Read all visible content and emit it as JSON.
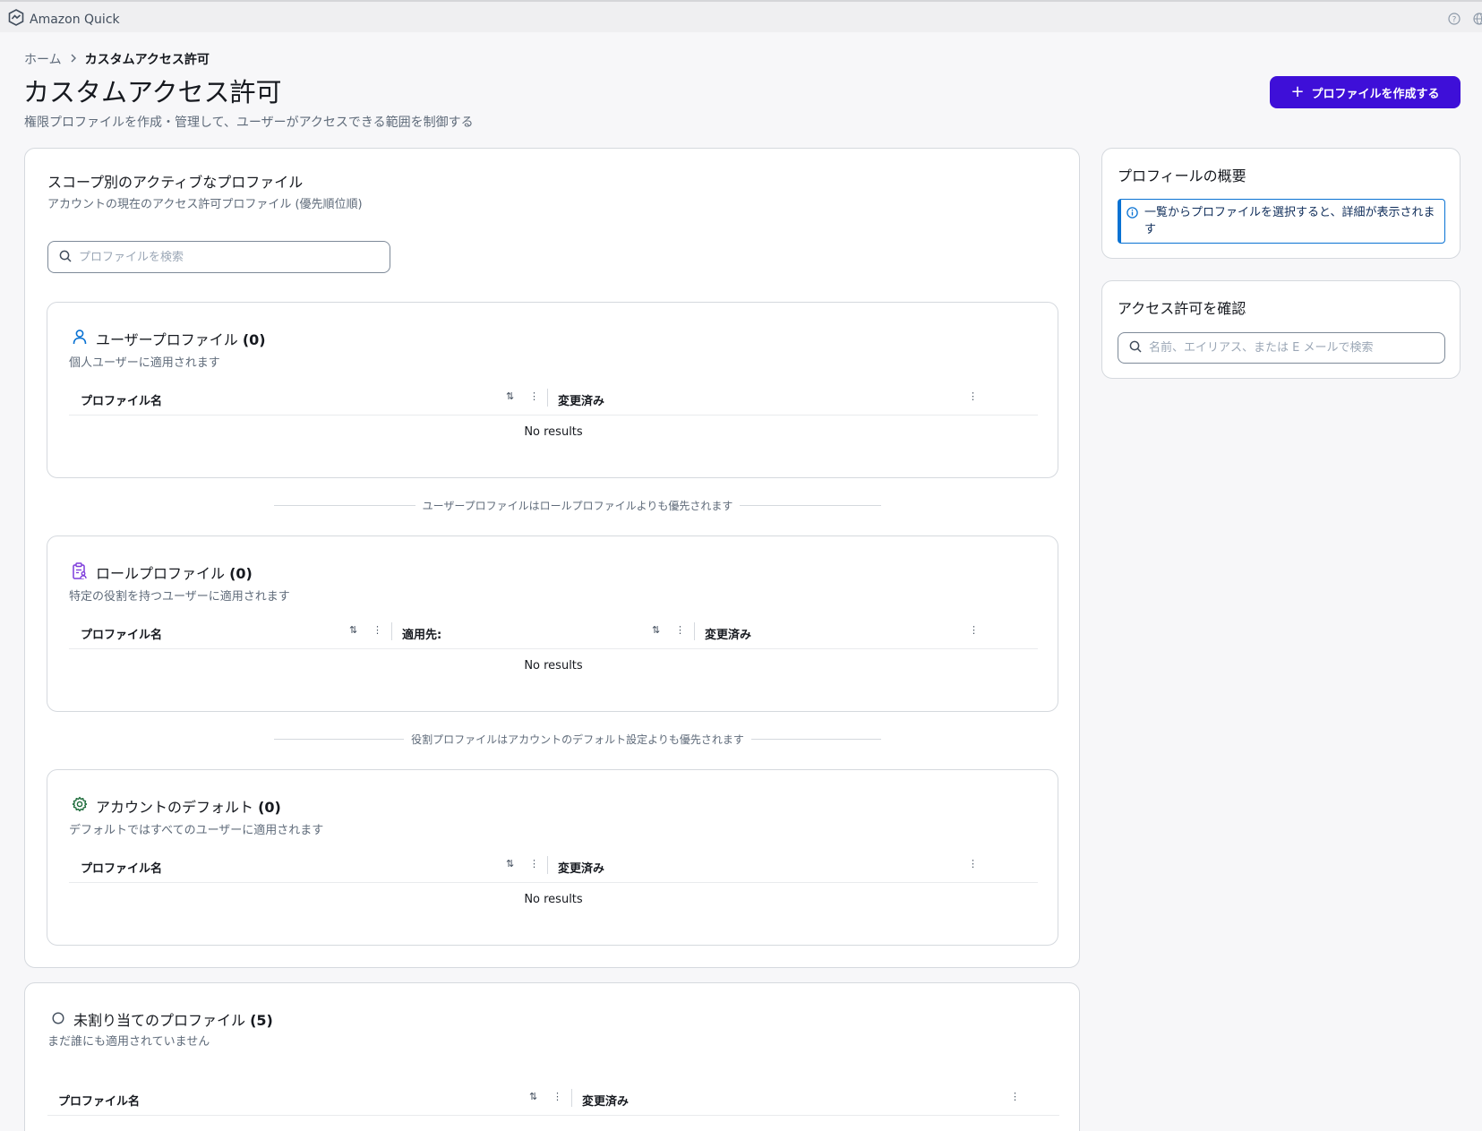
{
  "app": {
    "title": "Amazon Quick"
  },
  "breadcrumb": {
    "home": "ホーム",
    "current": "カスタムアクセス許可"
  },
  "page": {
    "title": "カスタムアクセス許可",
    "subtitle": "権限プロファイルを作成・管理して、ユーザーがアクセスできる範囲を制御する",
    "create_button": "プロファイルを作成する"
  },
  "active_profiles": {
    "title": "スコープ別のアクティブなプロファイル",
    "description": "アカウントの現在のアクセス許可プロファイル (優先順位順)",
    "search_placeholder": "プロファイルを検索"
  },
  "user_profiles": {
    "title": "ユーザープロファイル",
    "count": "(0)",
    "description": "個人ユーザーに適用されます",
    "columns": [
      "プロファイル名",
      "変更済み"
    ],
    "empty": "No results"
  },
  "note_user_over_role": "ユーザープロファイルはロールプロファイルよりも優先されます",
  "role_profiles": {
    "title": "ロールプロファイル",
    "count": "(0)",
    "description": "特定の役割を持つユーザーに適用されます",
    "columns": [
      "プロファイル名",
      "適用先:",
      "変更済み"
    ],
    "empty": "No results"
  },
  "note_role_over_default": "役割プロファイルはアカウントのデフォルト設定よりも優先されます",
  "account_default": {
    "title": "アカウントのデフォルト",
    "count": "(0)",
    "description": "デフォルトではすべてのユーザーに適用されます",
    "columns": [
      "プロファイル名",
      "変更済み"
    ],
    "empty": "No results"
  },
  "unassigned": {
    "title": "未割り当てのプロファイル",
    "count": "(5)",
    "description": "まだ誰にも適用されていません",
    "columns": [
      "プロファイル名",
      "変更済み"
    ]
  },
  "overview": {
    "title": "プロフィールの概要",
    "info": "一覧からプロファイルを選択すると、詳細が表示されます"
  },
  "check_access": {
    "title": "アクセス許可を確認",
    "search_placeholder": "名前、エイリアス、または E メールで検索"
  },
  "colors": {
    "accent": "#3e0fd8",
    "info": "#0972d3",
    "user_icon": "#0972d3",
    "role_icon": "#7d3bdb",
    "default_icon": "#1d6b3a"
  }
}
